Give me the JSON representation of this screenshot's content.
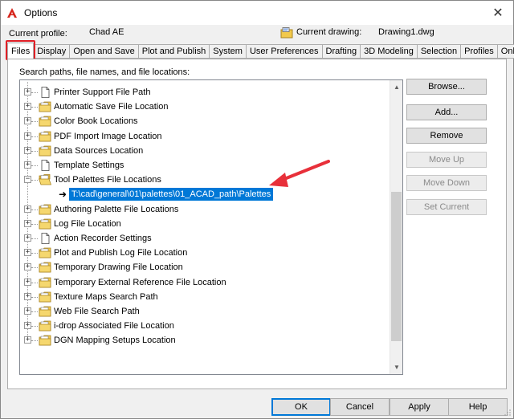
{
  "window": {
    "title": "Options",
    "close_glyph": "✕"
  },
  "profile": {
    "current_profile_label": "Current profile:",
    "current_profile_value": "Chad AE",
    "current_drawing_label": "Current drawing:",
    "current_drawing_value": "Drawing1.dwg"
  },
  "tabs": [
    {
      "label": "Files",
      "active": true
    },
    {
      "label": "Display"
    },
    {
      "label": "Open and Save"
    },
    {
      "label": "Plot and Publish"
    },
    {
      "label": "System"
    },
    {
      "label": "User Preferences"
    },
    {
      "label": "Drafting"
    },
    {
      "label": "3D Modeling"
    },
    {
      "label": "Selection"
    },
    {
      "label": "Profiles"
    },
    {
      "label": "Online"
    }
  ],
  "files_panel": {
    "search_label": "Search paths, file names, and file locations:",
    "tree_items": [
      {
        "label": "Printer Support File Path",
        "icon": "document-icon",
        "expander": "+"
      },
      {
        "label": "Automatic Save File Location",
        "icon": "folder-icon",
        "expander": "+"
      },
      {
        "label": "Color Book Locations",
        "icon": "folder-icon",
        "expander": "+"
      },
      {
        "label": "PDF Import Image Location",
        "icon": "folder-icon",
        "expander": "+"
      },
      {
        "label": "Data Sources Location",
        "icon": "folder-icon",
        "expander": "+"
      },
      {
        "label": "Template Settings",
        "icon": "document-icon",
        "expander": "+"
      },
      {
        "label": "Tool Palettes File Locations",
        "icon": "open-folder-icon",
        "expander": "−"
      },
      {
        "label": "Authoring Palette File Locations",
        "icon": "folder-icon",
        "expander": "+"
      },
      {
        "label": "Log File Location",
        "icon": "folder-icon",
        "expander": "+"
      },
      {
        "label": "Action Recorder Settings",
        "icon": "document-icon",
        "expander": "+"
      },
      {
        "label": "Plot and Publish Log File Location",
        "icon": "folder-icon",
        "expander": "+"
      },
      {
        "label": "Temporary Drawing File Location",
        "icon": "folder-icon",
        "expander": "+"
      },
      {
        "label": "Temporary External Reference File Location",
        "icon": "folder-icon",
        "expander": "+"
      },
      {
        "label": "Texture Maps Search Path",
        "icon": "folder-icon",
        "expander": "+"
      },
      {
        "label": "Web File Search Path",
        "icon": "folder-icon",
        "expander": "+"
      },
      {
        "label": "i-drop Associated File Location",
        "icon": "folder-icon",
        "expander": "+"
      },
      {
        "label": "DGN Mapping Setups Location",
        "icon": "folder-icon",
        "expander": "+"
      }
    ],
    "selected_path": "T:\\cad\\general\\01\\palettes\\01_ACAD_path\\Palettes",
    "selected_path_arrow": "➜",
    "side_buttons": {
      "browse": "Browse...",
      "add": "Add...",
      "remove": "Remove",
      "move_up": "Move Up",
      "move_down": "Move Down",
      "set_current": "Set Current"
    }
  },
  "bottom_buttons": {
    "ok": "OK",
    "cancel": "Cancel",
    "apply": "Apply",
    "help": "Help"
  },
  "colors": {
    "selection": "#0078d7",
    "highlight_box": "#e01f26",
    "annotation_arrow": "#e8303a",
    "folder": "#f2c94c"
  }
}
